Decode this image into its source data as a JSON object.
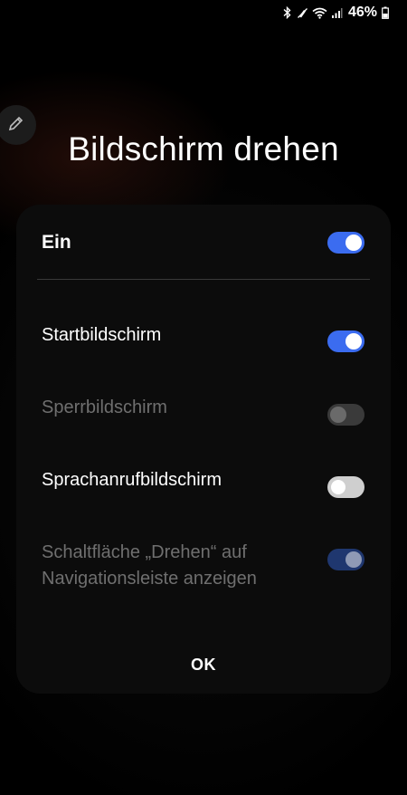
{
  "status_bar": {
    "icons": [
      "bluetooth-icon",
      "mute-icon",
      "wifi-icon",
      "signal-icon",
      "battery-icon"
    ],
    "battery_percent": "46%"
  },
  "dialog": {
    "title": "Bildschirm drehen",
    "master": {
      "label": "Ein",
      "state": "on"
    },
    "options": [
      {
        "label": "Startbildschirm",
        "state": "on",
        "enabled": true
      },
      {
        "label": "Sperrbildschirm",
        "state": "off",
        "enabled": false
      },
      {
        "label": "Sprachanrufbildschirm",
        "state": "off",
        "enabled": true
      },
      {
        "label_line1": "Schaltfläche „Drehen“ auf",
        "label_line2": "Navigationsleiste anzeigen",
        "state": "on",
        "enabled": false
      }
    ],
    "ok_label": "OK"
  },
  "colors": {
    "accent": "#3b6cf0",
    "background": "#000000",
    "card": "#0c0c0c",
    "disabled_text": "#6f6f6f"
  }
}
